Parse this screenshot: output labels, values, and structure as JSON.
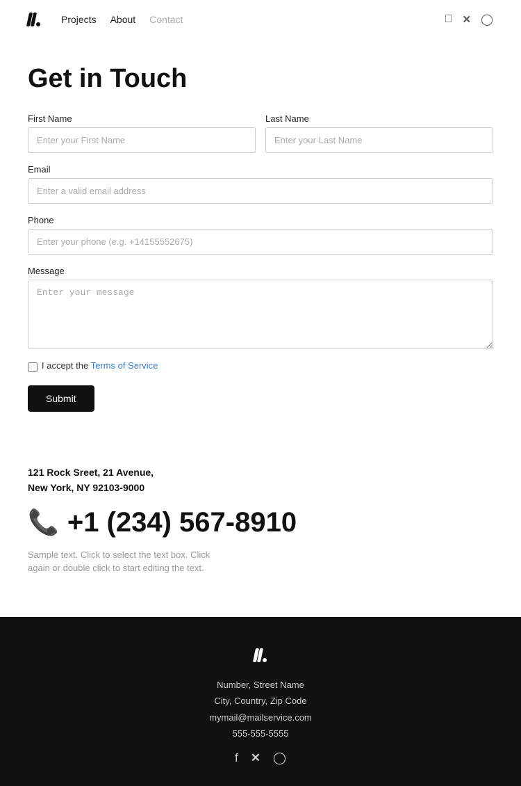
{
  "nav": {
    "links": [
      {
        "label": "Projects",
        "active": true
      },
      {
        "label": "About",
        "active": true
      },
      {
        "label": "Contact",
        "active": false
      }
    ]
  },
  "page": {
    "title": "Get in Touch"
  },
  "form": {
    "first_name_label": "First Name",
    "first_name_placeholder": "Enter your First Name",
    "last_name_label": "Last Name",
    "last_name_placeholder": "Enter your Last Name",
    "email_label": "Email",
    "email_placeholder": "Enter a valid email address",
    "phone_label": "Phone",
    "phone_placeholder": "Enter your phone (e.g. +14155552675)",
    "message_label": "Message",
    "message_placeholder": "Enter your message",
    "tos_text": "I accept the ",
    "tos_link_text": "Terms of Service",
    "submit_label": "Submit"
  },
  "contact": {
    "address_line1": "121 Rock Sreet, 21 Avenue,",
    "address_line2": "New York, NY 92103-9000",
    "phone": "+1 (234) 567-8910",
    "sample_text": "Sample text. Click to select the text box. Click again or double click to start editing the text."
  },
  "footer": {
    "address_line1": "Number, Street Name",
    "address_line2": "City, Country, Zip Code",
    "email": "mymail@mailservice.com",
    "phone": "555-555-5555"
  }
}
